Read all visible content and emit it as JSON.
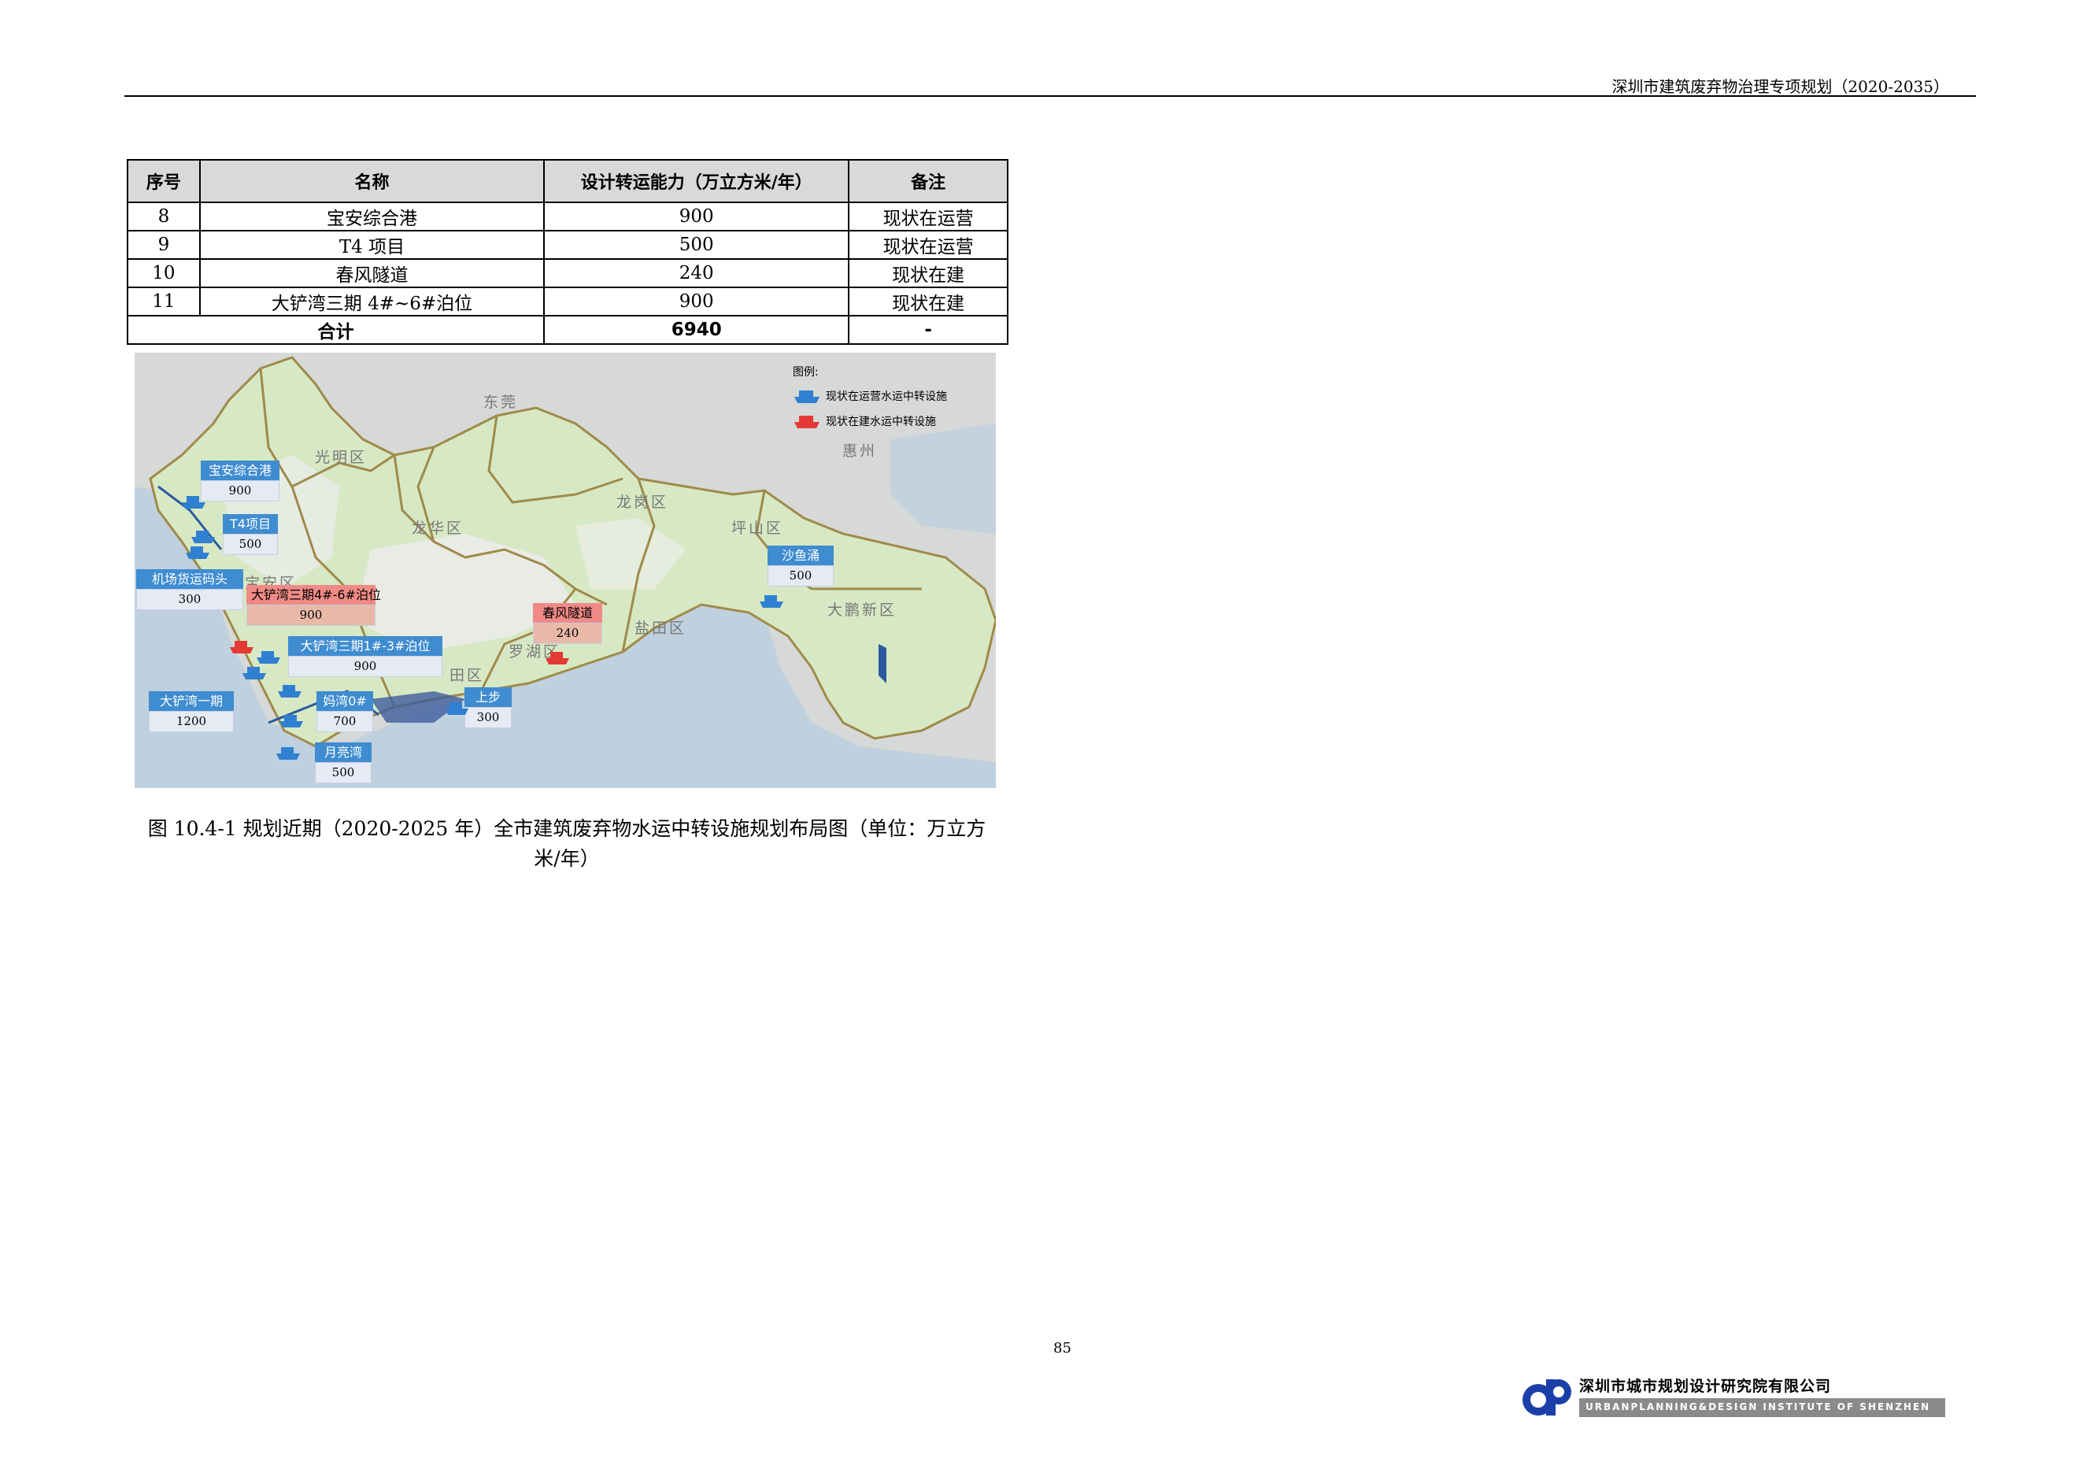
{
  "header": {
    "title": "深圳市建筑废弃物治理专项规划（2020-2035）"
  },
  "table": {
    "headers": [
      "序号",
      "名称",
      "设计转运能力（万立方米/年）",
      "备注"
    ],
    "rows": [
      {
        "no": "8",
        "name": "宝安综合港",
        "capacity": "900",
        "note": "现状在运营"
      },
      {
        "no": "9",
        "name": "T4 项目",
        "capacity": "500",
        "note": "现状在运营"
      },
      {
        "no": "10",
        "name": "春风隧道",
        "capacity": "240",
        "note": "现状在建"
      },
      {
        "no": "11",
        "name": "大铲湾三期 4#~6#泊位",
        "capacity": "900",
        "note": "现状在建"
      }
    ],
    "total": {
      "label": "合计",
      "capacity": "6940",
      "note": "-"
    }
  },
  "map": {
    "legend": {
      "title": "图例:",
      "items": [
        {
          "label": "现状在运营水运中转设施",
          "color": "#2f80d0",
          "icon": "ship-icon"
        },
        {
          "label": "现状在建水运中转设施",
          "color": "#e53935",
          "icon": "ship-icon"
        }
      ]
    },
    "regions": {
      "dongguan": "东莞",
      "huizhou": "惠州",
      "guangming": "光明区",
      "longhua": "龙华区",
      "longgang": "龙岗区",
      "pingshan": "坪山区",
      "baoan": "宝安区",
      "yantian": "盐田区",
      "luohu": "罗湖区",
      "dapeng": "大鹏新区",
      "futian_partial": "田区"
    },
    "facilities": {
      "baoan_port": {
        "name": "宝安综合港",
        "capacity": "900"
      },
      "t4": {
        "name": "T4项目",
        "capacity": "500"
      },
      "airport": {
        "name": "机场货运码头",
        "capacity": "300"
      },
      "dachan3_46": {
        "name": "大铲湾三期4#-6#泊位",
        "capacity": "900"
      },
      "dachan3_13": {
        "name": "大铲湾三期1#-3#泊位",
        "capacity": "900"
      },
      "dachan1": {
        "name": "大铲湾一期",
        "capacity": "1200"
      },
      "mawan": {
        "name": "妈湾0#",
        "capacity": "700"
      },
      "shangbu": {
        "name": "上步",
        "capacity": "300"
      },
      "yueliangwan": {
        "name": "月亮湾",
        "capacity": "500"
      },
      "chunfeng": {
        "name": "春风隧道",
        "capacity": "240"
      },
      "shayuchong": {
        "name": "沙鱼涌",
        "capacity": "500"
      }
    }
  },
  "caption": {
    "line1": "图 10.4-1 规划近期（2020-2025 年）全市建筑废弃物水运中转设施规划布局图（单位：万立方",
    "line2": "米/年）"
  },
  "page_number": "85",
  "footer": {
    "org_cn": "深圳市城市规划设计研究院有限公司",
    "org_en": "URBANPLANNING&DESIGN INSTITUTE OF SHENZHEN"
  }
}
